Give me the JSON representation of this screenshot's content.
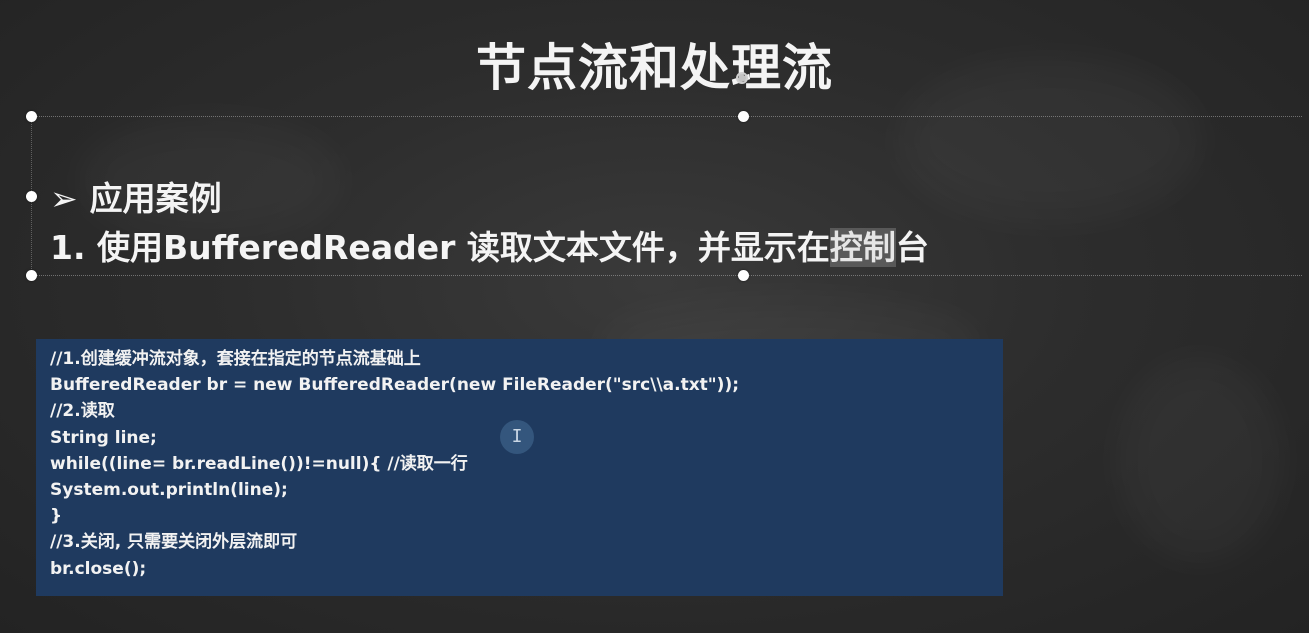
{
  "slide": {
    "title": "节点流和处理流",
    "bullet": {
      "arrow": "➢",
      "text": "应用案例"
    },
    "numbered": {
      "prefix": "1. 使用BufferedReader 读取文本文件，并显示在",
      "highlight": "控制",
      "suffix": "台"
    },
    "code_lines": [
      "//1.创建缓冲流对象，套接在指定的节点流基础上",
      "BufferedReader br = new BufferedReader(new FileReader(\"src\\\\a.txt\"));",
      "//2.读取",
      "String line;",
      "while((line= br.readLine())!=null){ //读取一行",
      "System.out.println(line);",
      "}",
      "//3.关闭, 只需要关闭外层流即可",
      "br.close();"
    ],
    "cursor_glyph": "I",
    "colors": {
      "background": "#2d2d2d",
      "code_background": "#1f3a5f",
      "text": "#f4f4f4"
    }
  }
}
